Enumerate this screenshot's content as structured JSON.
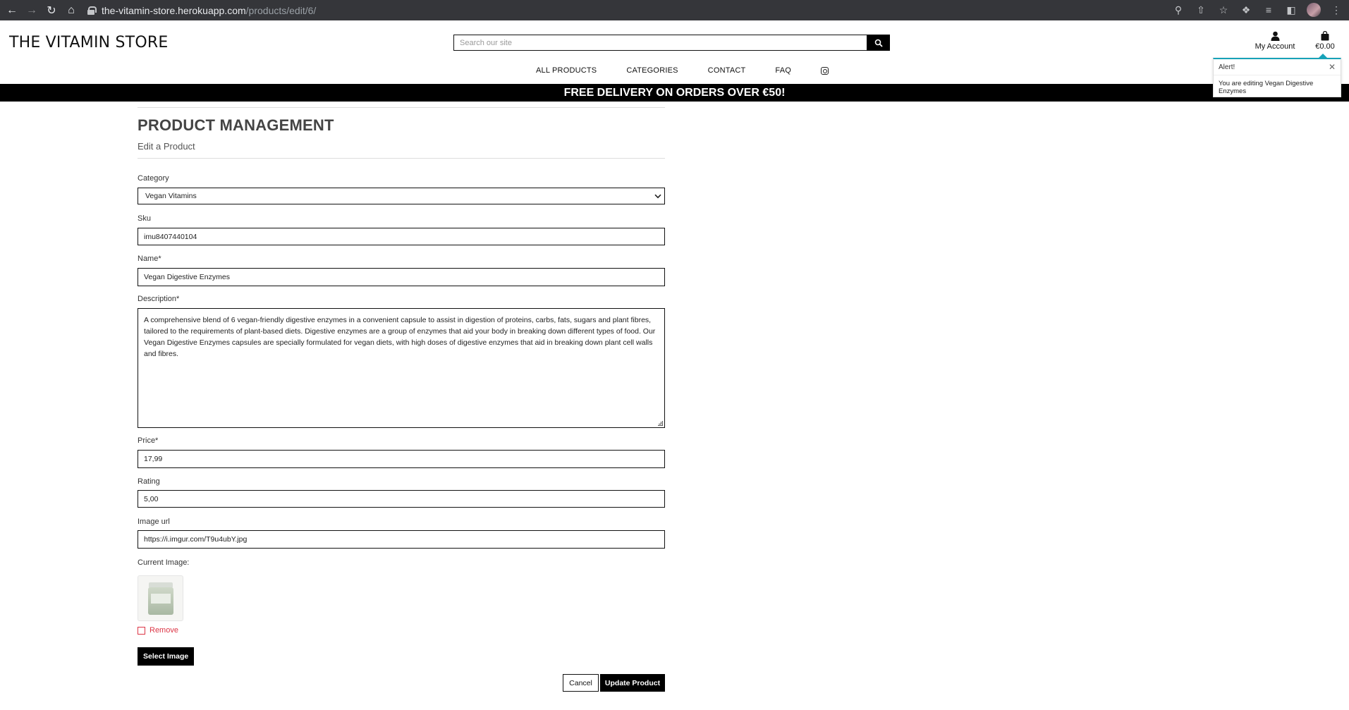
{
  "browser": {
    "url_host": "the-vitamin-store.herokuapp.com",
    "url_path": "/products/edit/6/"
  },
  "header": {
    "logo": "THE VITAMIN STORE",
    "search_placeholder": "Search our site",
    "account_label": "My Account",
    "bag_total": "€0.00"
  },
  "nav": {
    "items": [
      "ALL PRODUCTS",
      "CATEGORIES",
      "CONTACT",
      "FAQ"
    ]
  },
  "banner": "FREE DELIVERY ON ORDERS OVER €50!",
  "toast": {
    "title": "Alert!",
    "message": "You are editing Vegan Digestive Enzymes",
    "accent": "#17a2b8"
  },
  "page": {
    "title": "PRODUCT MANAGEMENT",
    "subtitle": "Edit a Product"
  },
  "form": {
    "category_label": "Category",
    "category_value": "Vegan Vitamins",
    "sku_label": "Sku",
    "sku_value": "imu8407440104",
    "name_label": "Name*",
    "name_value": "Vegan Digestive Enzymes",
    "description_label": "Description*",
    "description_value": "A comprehensive blend of 6 vegan-friendly digestive enzymes in a convenient capsule to assist in digestion of proteins, carbs, fats, sugars and plant fibres, tailored to the requirements of plant-based diets. Digestive enzymes are a group of enzymes that aid your body in breaking down different types of food. Our Vegan Digestive Enzymes capsules are specially formulated for vegan diets, with high doses of digestive enzymes that aid in breaking down plant cell walls and fibres.",
    "price_label": "Price*",
    "price_value": "17,99",
    "rating_label": "Rating",
    "rating_value": "5,00",
    "image_url_label": "Image url",
    "image_url_value": "https://i.imgur.com/T9u4ubY.jpg",
    "current_image_label": "Current Image:",
    "remove_label": "Remove",
    "select_image_label": "Select Image",
    "cancel_label": "Cancel",
    "update_label": "Update Product"
  }
}
